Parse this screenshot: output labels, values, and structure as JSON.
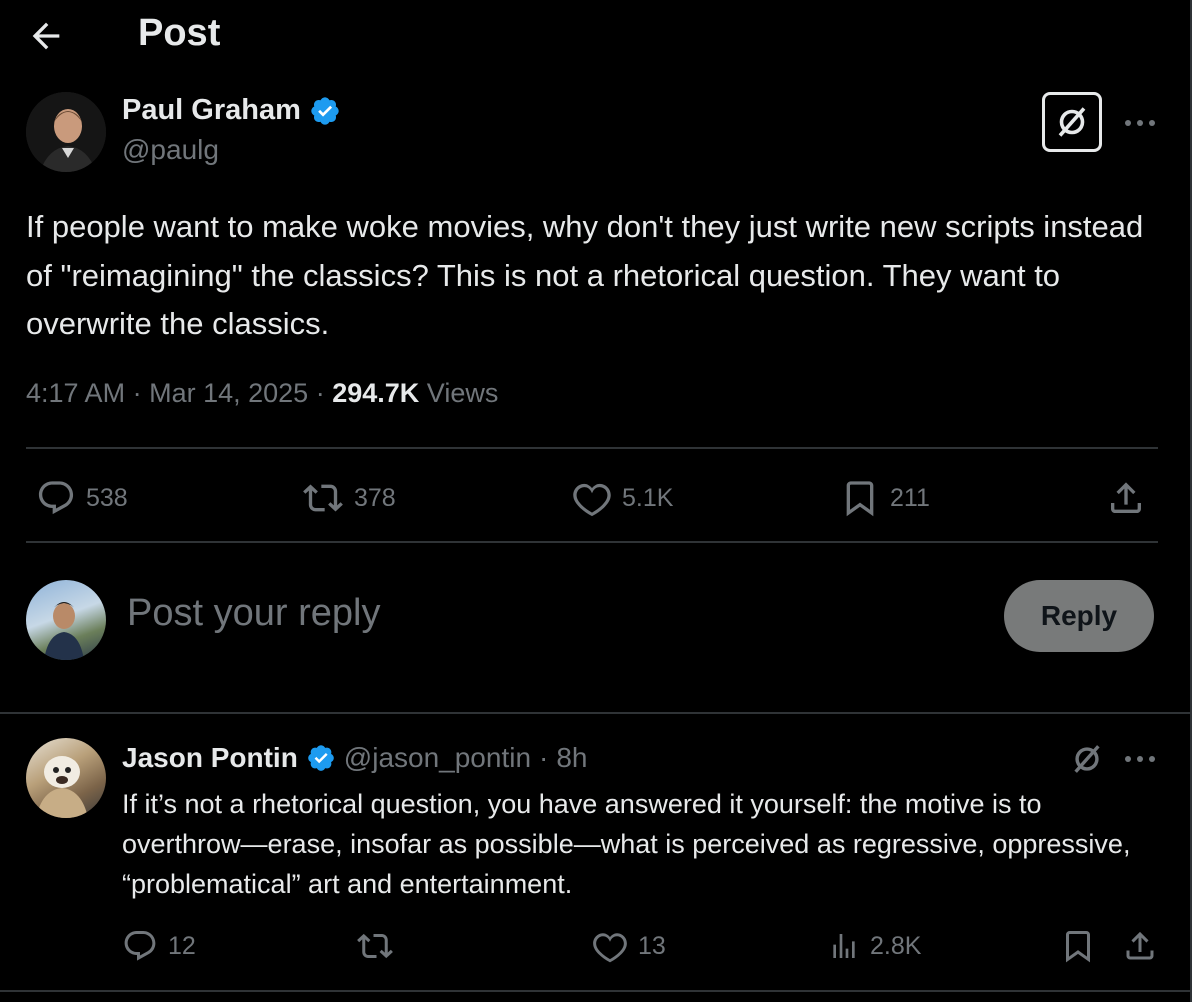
{
  "header": {
    "title": "Post"
  },
  "post": {
    "author": {
      "name": "Paul Graham",
      "handle": "@paulg"
    },
    "text": "If people want to make woke movies, why don't they just write new scripts instead of \"reimagining\" the classics? This is not a rhetorical question. They want to overwrite the classics.",
    "time": "4:17 AM",
    "date": "Mar 14, 2025",
    "views_count": "294.7K",
    "views_label": "Views",
    "stats": {
      "replies": "538",
      "reposts": "378",
      "likes": "5.1K",
      "bookmarks": "211"
    }
  },
  "composer": {
    "placeholder": "Post your reply",
    "button": "Reply"
  },
  "reply": {
    "author": {
      "name": "Jason Pontin",
      "handle": "@jason_pontin",
      "age": "8h"
    },
    "text": "If it’s not a rhetorical question, you have answered it yourself: the motive is to overthrow—erase, insofar as possible—what is perceived as regressive, oppressive, “problematical” art and entertainment.",
    "stats": {
      "replies": "12",
      "likes": "13",
      "views": "2.8K"
    }
  },
  "colors": {
    "verified": "#1d9bf0",
    "text": "#e7e9ea",
    "muted": "#71767b",
    "border": "#2f3336",
    "reply_button": "#787a7a"
  }
}
